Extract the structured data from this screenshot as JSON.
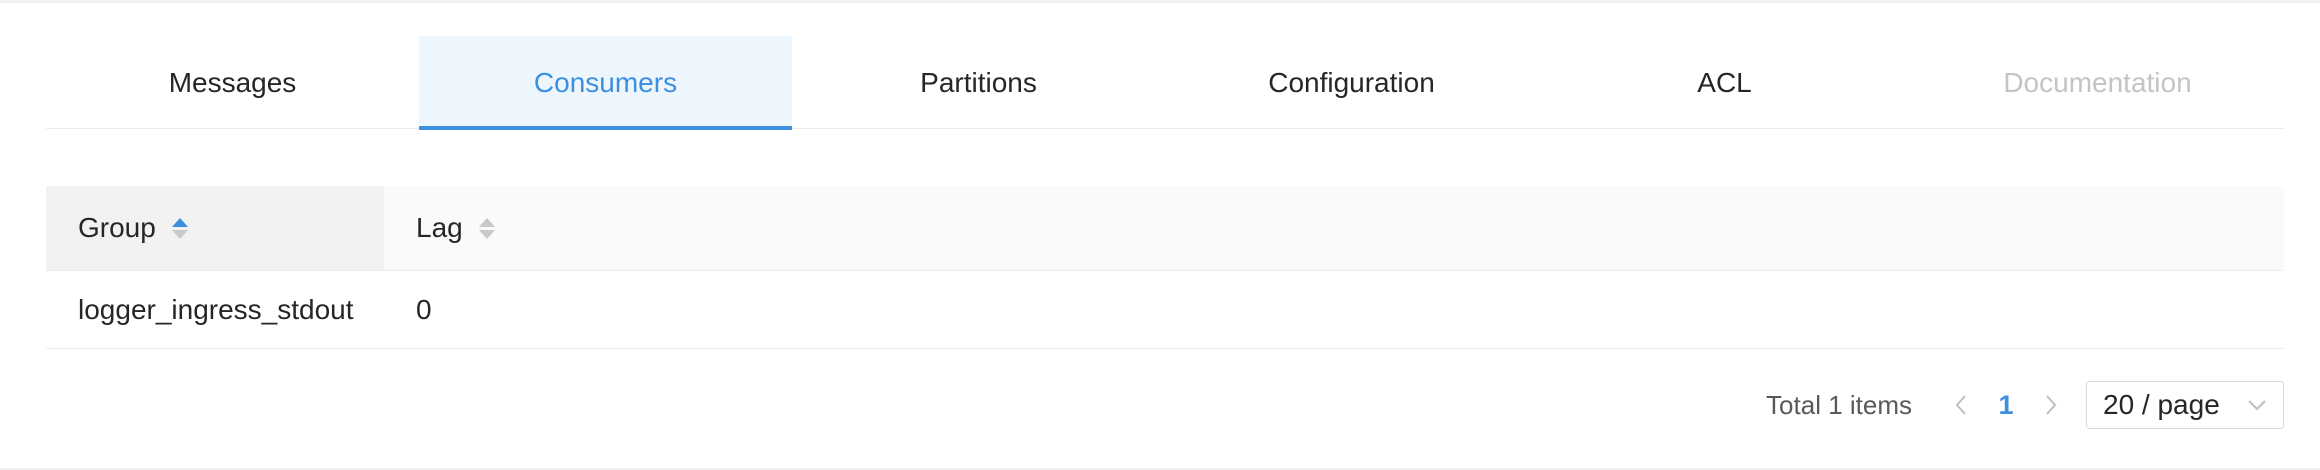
{
  "tabs": [
    {
      "label": "Messages",
      "state": "normal"
    },
    {
      "label": "Consumers",
      "state": "active"
    },
    {
      "label": "Partitions",
      "state": "normal"
    },
    {
      "label": "Configuration",
      "state": "normal"
    },
    {
      "label": "ACL",
      "state": "normal"
    },
    {
      "label": "Documentation",
      "state": "disabled"
    }
  ],
  "table": {
    "columns": [
      {
        "label": "Group",
        "sort": "ascending"
      },
      {
        "label": "Lag",
        "sort": "none"
      }
    ],
    "rows": [
      {
        "group": "logger_ingress_stdout",
        "lag": "0"
      }
    ]
  },
  "pagination": {
    "total_text": "Total 1 items",
    "current_page": "1",
    "page_size": "20 / page",
    "prev_icon": "chevron-left-icon",
    "next_icon": "chevron-right-icon",
    "select_icon": "chevron-down-icon"
  },
  "colors": {
    "accent": "#3d8fe0",
    "active_tab_bg": "#eef6fd",
    "disabled_text": "#c4c4c4"
  }
}
